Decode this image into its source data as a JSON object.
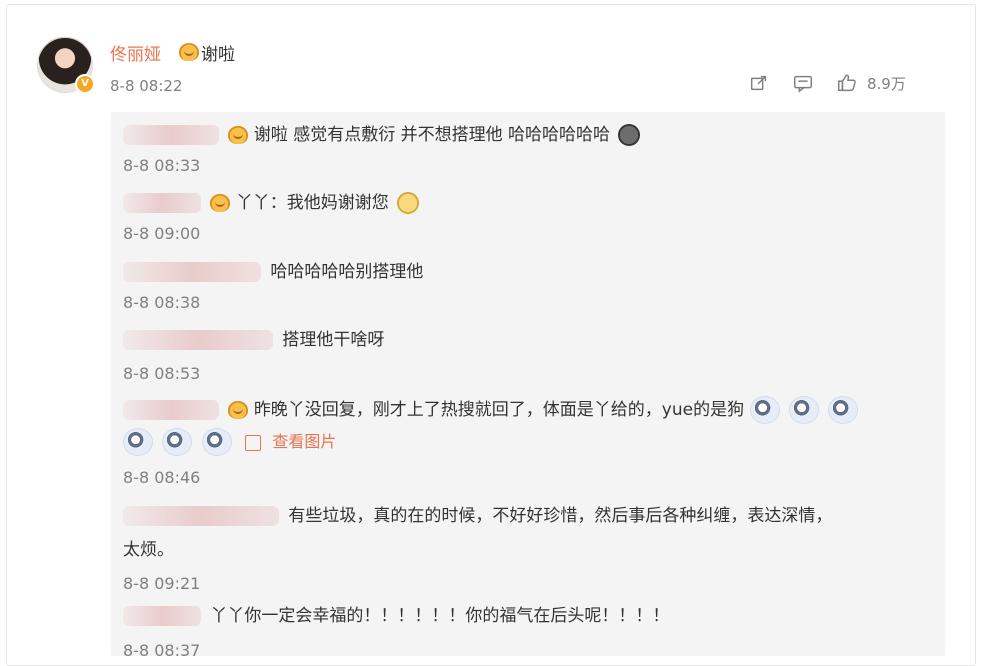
{
  "post": {
    "author_name": "佟丽娅",
    "author_reply": "谢啦",
    "post_time": "8-8 08:22",
    "like_count": "8.9万",
    "icons": {
      "author_emoji": "heart-face-icon",
      "share": "share-icon",
      "comment": "comment-icon",
      "like": "thumb-icon"
    }
  },
  "comments": [
    {
      "text": "谢啦 感觉有点敷衍 并不想搭理他 哈哈哈哈哈哈",
      "time": "8-8 08:33"
    },
    {
      "text": "丫丫：我他妈谢谢您",
      "time": "8-8 09:00"
    },
    {
      "text": "哈哈哈哈哈别搭理他",
      "time": "8-8 08:38"
    },
    {
      "text": "搭理他干啥呀",
      "time": "8-8 08:53"
    },
    {
      "text": "昨晚丫没回复，刚才上了热搜就回了，体面是丫给的，yue的是狗",
      "view_pic": "查看图片",
      "time": "8-8 08:46"
    },
    {
      "text": "有些垃圾，真的在的时候，不好好珍惜，然后事后各种纠缠，表达深情，",
      "text2": "太烦。",
      "time": "8-8 09:21"
    },
    {
      "text": "丫丫你一定会幸福的！！！！！！你的福气在后头呢！！！！",
      "time": "8-8 08:37"
    }
  ],
  "colors": {
    "accent": "#eb7350",
    "text": "#333333",
    "muted": "#808080",
    "thread_bg": "#f4f4f4"
  }
}
